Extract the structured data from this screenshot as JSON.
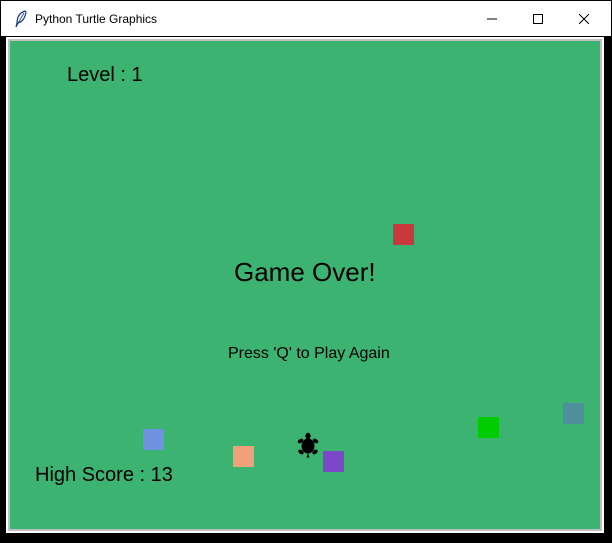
{
  "window": {
    "title": "Python Turtle Graphics",
    "app_icon": "feather-icon",
    "controls": [
      "minimize-icon",
      "maximize-icon",
      "close-icon"
    ]
  },
  "game": {
    "level_text": "Level : 1",
    "game_over_text": "Game Over!",
    "restart_prompt": "Press 'Q' to Play Again",
    "high_score_text": "High Score : 13",
    "background_color": "#3cb371",
    "player": {
      "icon": "turtle-icon",
      "color": "#000000"
    },
    "tiles": [
      {
        "name": "red-tile",
        "color": "#c8383c"
      },
      {
        "name": "slate-tile",
        "color": "#4f8f9c"
      },
      {
        "name": "green-tile",
        "color": "#00cc00"
      },
      {
        "name": "blue-tile",
        "color": "#7093e0"
      },
      {
        "name": "salmon-tile",
        "color": "#f0a07a"
      },
      {
        "name": "purple-tile",
        "color": "#7a48c8"
      }
    ]
  }
}
